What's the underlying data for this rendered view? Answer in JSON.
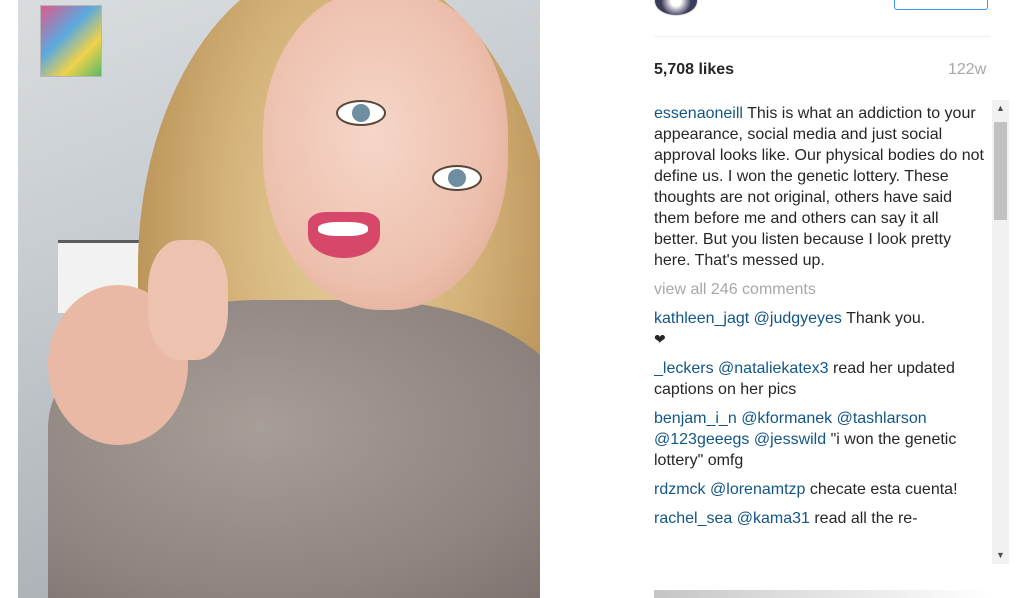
{
  "post": {
    "likes": "5,708 likes",
    "age": "122w",
    "caption_user": "essenaoneill",
    "caption_text": " This is what an addiction to your appearance, social media and just social approval looks like. Our physical bodies do not define us. I won the genetic lottery. These thoughts are not original, others have said them before me and others can say it all better. But you listen because I look pretty here. That's messed up.",
    "view_all": "view all 246 comments"
  },
  "comments": [
    {
      "user": "kathleen_jagt",
      "mentions": "@judgyeyes",
      "text": " Thank you.",
      "extra": "❤"
    },
    {
      "user": "_leckers",
      "mentions": "@nataliekatex3",
      "text": " read her updated captions on her pics"
    },
    {
      "user": "benjam_i_n",
      "mentions": "@kformanek @tashlarson @123geeegs @jesswild",
      "text": " \"i won the genetic lottery\" omfg"
    },
    {
      "user": "rdzmck",
      "mentions": "@lorenamtzp",
      "text": " checate esta cuenta!"
    },
    {
      "user": "rachel_sea",
      "mentions": "@kama31",
      "text": " read all the re-"
    }
  ],
  "scrollbar": {
    "up": "▲",
    "down": "▼"
  },
  "colors": {
    "link": "#125688",
    "muted": "#a5a7aa",
    "text": "#262626",
    "button_border": "#3897f0"
  }
}
